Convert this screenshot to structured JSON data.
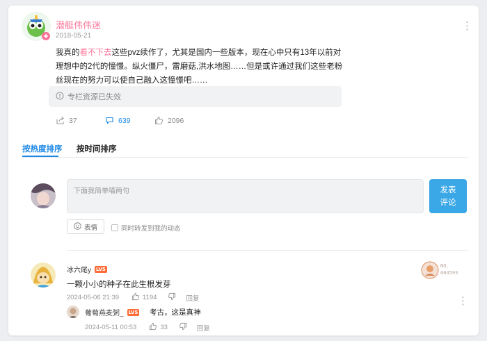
{
  "post": {
    "author": "潜艇伟伟迷",
    "date": "2018-05-21",
    "text_before": "我真的",
    "text_highlight": "看不下去",
    "text_after": "这些pvz续作了，尤其是国内一些版本，现在心中只有13年以前对理想中的2代的憧憬。纵火僵尸，雷磨菇,洪水地图……但是或许通过我们这些老粉丝现在的努力可以使自己融入这憧憬吧……",
    "expired_label": "专栏资源已失效",
    "share_count": "37",
    "comment_count": "639",
    "like_count": "2096"
  },
  "tabs": [
    {
      "label": "按热度排序",
      "active": true
    },
    {
      "label": "按时间排序",
      "active": false
    }
  ],
  "composer": {
    "placeholder": "下面我简单喵两句",
    "send_line1": "发表",
    "send_line2": "评论",
    "emoji_label": "表情",
    "repost_label": "同时转发到我的动态"
  },
  "comments": [
    {
      "user": "冰六尾y",
      "level": "LV5",
      "text": "一颗小小的种子在此生根发芽",
      "time": "2024-05-06 21:39",
      "likes": "1194",
      "reply_label": "回复",
      "badge_line1": "NO.",
      "badge_line2": "004593",
      "replies": [
        {
          "user": "葡萄燕麦粥_",
          "level": "LV5",
          "text": "考古，这是真神",
          "time": "2024-05-11 00:53",
          "likes": "33",
          "reply_label": "回复"
        }
      ]
    }
  ],
  "colors": {
    "accent_blue": "#1e88e5",
    "button_blue": "#3aa7e6",
    "pink": "#fb7299",
    "level_orange": "#ff6d38"
  }
}
